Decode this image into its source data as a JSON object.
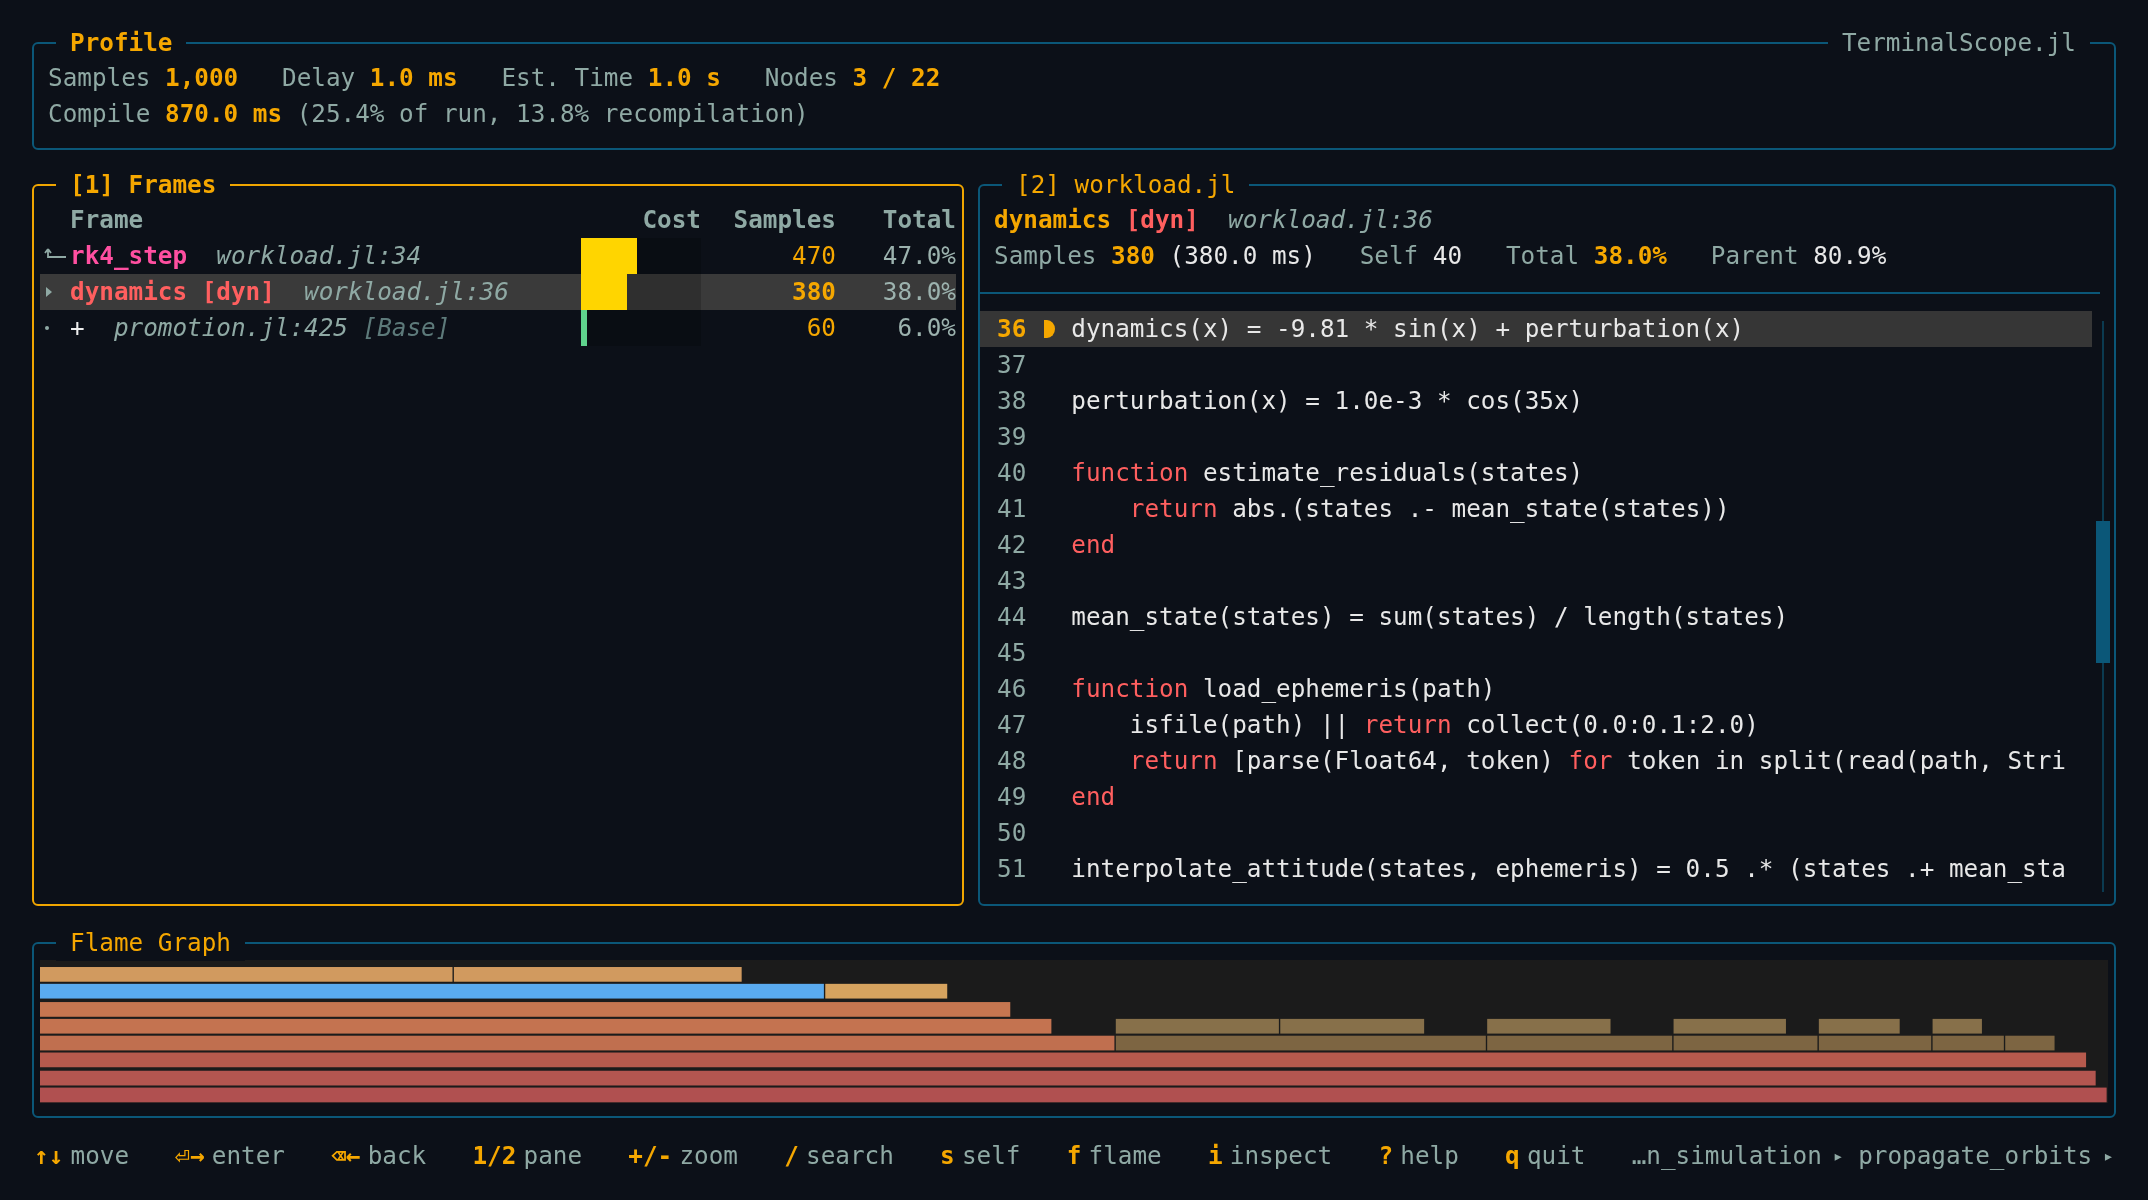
{
  "header": {
    "title": "Profile",
    "app_name": "TerminalScope.jl",
    "focused": false,
    "stats": [
      {
        "label": "Samples",
        "value": "1,000"
      },
      {
        "label": "Delay",
        "value": "1.0 ms"
      },
      {
        "label": "Est. Time",
        "value": "1.0 s"
      },
      {
        "label": "Nodes",
        "value": "3 / 22"
      }
    ],
    "compile": {
      "label": "Compile",
      "value": "870.0 ms",
      "detail": "(25.4% of run, 13.8% recompilation)"
    }
  },
  "frames_panel": {
    "title": "[1] Frames",
    "focused": true,
    "columns": [
      "Frame",
      "Cost",
      "Samples",
      "Total"
    ],
    "rows": [
      {
        "kind": "parent",
        "name": "rk4_step",
        "file": "workload.jl:34",
        "cost": {
          "level": 0.47,
          "color": "#ffd500"
        },
        "samples": "470",
        "total": "47.0%",
        "selected": false
      },
      {
        "kind": "current",
        "name": "dynamics",
        "tag": "[dyn]",
        "file": "workload.jl:36",
        "cost": {
          "level": 0.38,
          "color": "#ffd500"
        },
        "samples": "380",
        "total": "38.0%",
        "selected": true
      },
      {
        "kind": "child",
        "name": "+",
        "file": "promotion.jl:425",
        "module": "[Base]",
        "cost": {
          "level": 0.05,
          "color": "#5fd38d"
        },
        "samples": "60",
        "total": "6.0%",
        "selected": false
      }
    ]
  },
  "code_panel": {
    "title": "[2] workload.jl",
    "focused": false,
    "frame": {
      "name": "dynamics",
      "tag": "[dyn]",
      "file": "workload.jl:36"
    },
    "stats": [
      {
        "label": "Samples",
        "value": "380",
        "detail": "(380.0 ms)",
        "highlight": true
      },
      {
        "label": "Self",
        "value": "40",
        "highlight": false
      },
      {
        "label": "Total",
        "value": "38.0%",
        "highlight": true
      },
      {
        "label": "Parent",
        "value": "80.9%",
        "highlight": false
      }
    ],
    "lines": [
      {
        "number": "36",
        "selected": true,
        "tokens": [
          {
            "kind": "code",
            "text": "dynamics(x) = -9.81 * sin(x) + perturbation(x)"
          }
        ]
      },
      {
        "number": "37",
        "selected": false
      },
      {
        "number": "38",
        "selected": false,
        "tokens": [
          {
            "kind": "code",
            "text": "perturbation(x) = 1.0e-3 * cos(35x)"
          }
        ]
      },
      {
        "number": "39",
        "selected": false
      },
      {
        "number": "40",
        "selected": false,
        "tokens": [
          {
            "kind": "keyword",
            "text": "function"
          },
          {
            "kind": "code",
            "text": " estimate_residuals(states)"
          }
        ]
      },
      {
        "number": "41",
        "selected": false,
        "tokens": [
          {
            "kind": "keyword",
            "text": "    return"
          },
          {
            "kind": "code",
            "text": " abs.(states .- mean_state(states))"
          }
        ]
      },
      {
        "number": "42",
        "selected": false,
        "tokens": [
          {
            "kind": "keyword",
            "text": "end"
          }
        ]
      },
      {
        "number": "43",
        "selected": false
      },
      {
        "number": "44",
        "selected": false,
        "tokens": [
          {
            "kind": "code",
            "text": "mean_state(states) = sum(states) / length(states)"
          }
        ]
      },
      {
        "number": "45",
        "selected": false
      },
      {
        "number": "46",
        "selected": false,
        "tokens": [
          {
            "kind": "keyword",
            "text": "function"
          },
          {
            "kind": "code",
            "text": " load_ephemeris(path)"
          }
        ]
      },
      {
        "number": "47",
        "selected": false,
        "tokens": [
          {
            "kind": "code",
            "text": "    isfile(path) || "
          },
          {
            "kind": "keyword",
            "text": "return"
          },
          {
            "kind": "code",
            "text": " collect(0.0:0.1:2.0)"
          }
        ]
      },
      {
        "number": "48",
        "selected": false,
        "tokens": [
          {
            "kind": "keyword",
            "text": "    return"
          },
          {
            "kind": "code",
            "text": " [parse(Float64, token) "
          },
          {
            "kind": "keyword",
            "text": "for"
          },
          {
            "kind": "code",
            "text": " token in split(read(path, Stri"
          }
        ]
      },
      {
        "number": "49",
        "selected": false,
        "tokens": [
          {
            "kind": "keyword",
            "text": "end"
          }
        ]
      },
      {
        "number": "50",
        "selected": false
      },
      {
        "number": "51",
        "selected": false,
        "tokens": [
          {
            "kind": "code",
            "text": "interpolate_attitude(states, ephemeris) = 0.5 .* (states .+ mean_sta"
          }
        ]
      }
    ]
  },
  "flame_panel": {
    "title": "Flame Graph",
    "focused": false
  },
  "footer": {
    "keys": [
      {
        "key": "↑↓",
        "label": "move"
      },
      {
        "key": "⏎→",
        "label": "enter"
      },
      {
        "key": "⌫←",
        "label": "back"
      },
      {
        "key": "1/2",
        "label": "pane"
      },
      {
        "key": "+/-",
        "label": "zoom"
      },
      {
        "key": "/",
        "label": "search"
      },
      {
        "key": "s",
        "label": "self"
      },
      {
        "key": "f",
        "label": "flame"
      },
      {
        "key": "i",
        "label": "inspect"
      },
      {
        "key": "?",
        "label": "help"
      },
      {
        "key": "q",
        "label": "quit"
      }
    ],
    "breadcrumb": [
      {
        "kind": "crumb",
        "text": "…n_simulation"
      },
      {
        "kind": "separator",
        "text": "▸"
      },
      {
        "kind": "crumb",
        "text": "propagate_orbits"
      },
      {
        "kind": "separator",
        "text": "▸"
      }
    ]
  }
}
